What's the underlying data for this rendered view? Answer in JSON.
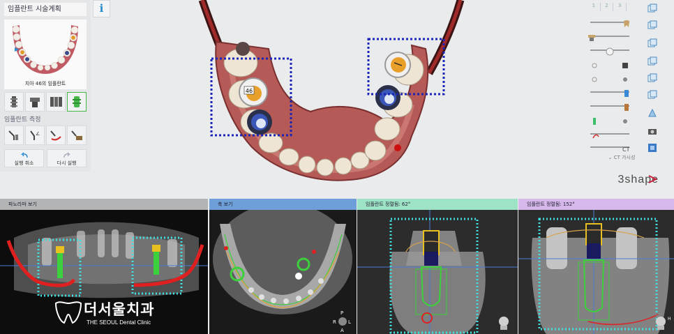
{
  "left_panel": {
    "title": "임플란트 시술계획",
    "info_label": "i",
    "thumbnail_caption": "치아 46의 임플란트",
    "measure_section": "임플란트 측정",
    "undo_label": "실행 취소",
    "redo_label": "다시 실행"
  },
  "viewport": {
    "tooth_number": "46"
  },
  "right_panel": {
    "layer_tabs": [
      "1",
      "2",
      "3"
    ],
    "ct_toggle_label": "CT 가시성",
    "brand": "3shape",
    "sliders": [
      {
        "name": "tooth-opacity",
        "level": 0.92
      },
      {
        "name": "implant-opacity",
        "level": 0.55
      },
      {
        "name": "crown-opacity",
        "level": 0.4
      },
      {
        "name": "scan-opacity",
        "level": 0.9
      },
      {
        "name": "abutment-opacity",
        "level": 0.5
      },
      {
        "name": "guide-opacity",
        "level": 0.9
      },
      {
        "name": "sleeve-opacity",
        "level": 0.5
      },
      {
        "name": "nerve-opacity",
        "level": 0.6
      },
      {
        "name": "ct-opacity",
        "level": 0.95
      }
    ]
  },
  "panes": {
    "panoramic": {
      "title": "파노라마 보기"
    },
    "axial": {
      "title": "축 보기"
    },
    "cross1": {
      "title": "임플란트 정렬됨: 62°"
    },
    "cross2": {
      "title": "임플란트 정렬됨: 152°"
    }
  },
  "clinic": {
    "name": "더서울치과",
    "subtitle": "THE SEOUL Dental Clinic"
  },
  "orientation": {
    "axial_labels": [
      "P",
      "R",
      "L",
      "A"
    ],
    "cross_label": "H"
  },
  "colors": {
    "selection_dashed": "#1a24b8",
    "cyan_box": "#40e0e0",
    "nerve": "#e02020",
    "implant_outline": "#3cd03c",
    "header_panoramic": "#b2b4b6",
    "header_axial": "#6f9fd8",
    "header_cross1": "#9fe3c6",
    "header_cross2": "#d6b8ea"
  }
}
